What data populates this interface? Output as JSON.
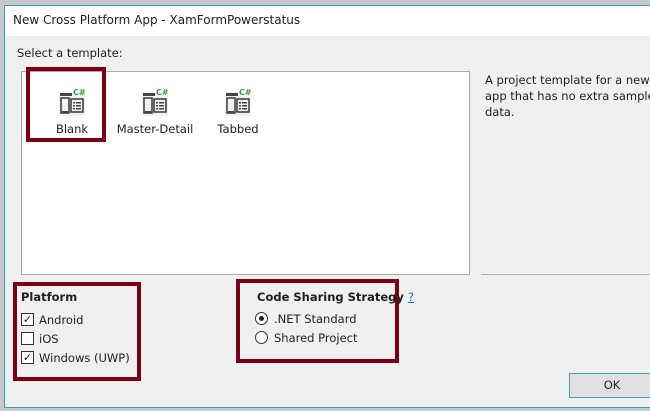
{
  "window": {
    "title": "New Cross Platform App - XamFormPowerstatus"
  },
  "template_section": {
    "label": "Select a template:",
    "templates": [
      {
        "label": "Blank",
        "selected": true,
        "icon": "csharp-template-icon"
      },
      {
        "label": "Master-Detail",
        "selected": false,
        "icon": "csharp-template-icon"
      },
      {
        "label": "Tabbed",
        "selected": false,
        "icon": "csharp-template-icon"
      }
    ],
    "description": "A project template for a new Xa app that has no extra sample pa data."
  },
  "platform": {
    "label": "Platform",
    "options": [
      {
        "label": "Android",
        "checked": true
      },
      {
        "label": "iOS",
        "checked": false
      },
      {
        "label": "Windows (UWP)",
        "checked": true
      }
    ]
  },
  "code_sharing": {
    "label": "Code Sharing Strategy",
    "help": "?",
    "options": [
      {
        "label": ".NET Standard",
        "selected": true
      },
      {
        "label": "Shared Project",
        "selected": false
      }
    ]
  },
  "buttons": {
    "ok": "OK"
  },
  "colors": {
    "highlight": "#7d0016",
    "accent": "#2aa0c8",
    "csharp": "#3c9a3c"
  }
}
